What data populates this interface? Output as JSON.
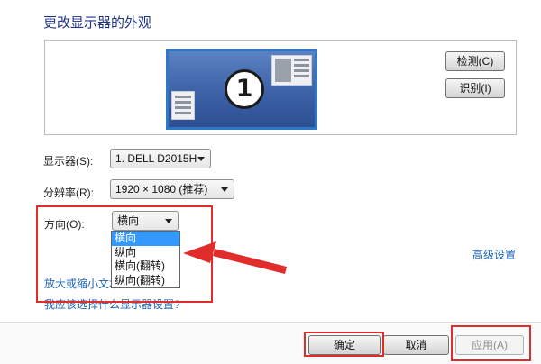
{
  "header": {
    "title": "更改显示器的外观"
  },
  "preview": {
    "monitor_number": "1",
    "detect_label": "检测(C)",
    "identify_label": "识别(I)"
  },
  "settings": {
    "display_label": "显示器(S):",
    "display_value": "1. DELL D2015H",
    "resolution_label": "分辨率(R):",
    "resolution_value": "1920 × 1080 (推荐)",
    "orientation_label": "方向(O):",
    "orientation_value": "横向",
    "orientation_options": [
      "横向",
      "纵向",
      "横向(翻转)",
      "纵向(翻转)"
    ]
  },
  "links": {
    "advanced": "高级设置",
    "text_size": "放大或缩小文本",
    "how_choose": "我应该选择什么显示器设置?"
  },
  "footer": {
    "ok_label": "确定",
    "cancel_label": "取消",
    "apply_label": "应用(A)"
  },
  "colors": {
    "annotation_red": "#e12c2c",
    "link_blue": "#1e64b4",
    "title_blue": "#1e3287",
    "selection_blue": "#3399ff"
  }
}
